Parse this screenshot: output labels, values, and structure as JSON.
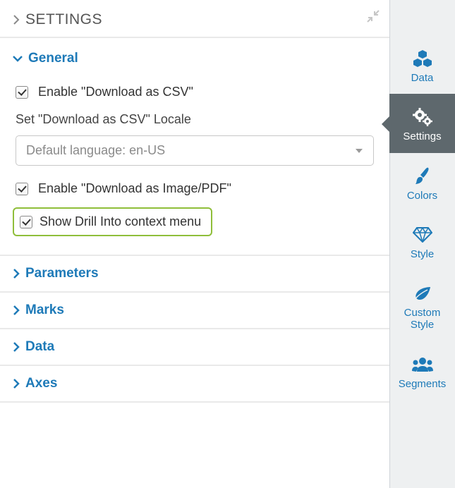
{
  "header": {
    "title": "SETTINGS"
  },
  "general": {
    "title": "General",
    "enable_csv_label": "Enable \"Download as CSV\"",
    "enable_csv_checked": true,
    "locale_label": "Set \"Download as CSV\" Locale",
    "locale_value": "Default language: en-US",
    "enable_img_label": "Enable \"Download as Image/PDF\"",
    "enable_img_checked": true,
    "drill_label": "Show Drill Into context menu",
    "drill_checked": true
  },
  "sections": {
    "parameters": "Parameters",
    "marks": "Marks",
    "data": "Data",
    "axes": "Axes"
  },
  "rail": {
    "data": "Data",
    "settings": "Settings",
    "colors": "Colors",
    "style": "Style",
    "custom_style": "Custom Style",
    "segments": "Segments",
    "active": "settings"
  }
}
